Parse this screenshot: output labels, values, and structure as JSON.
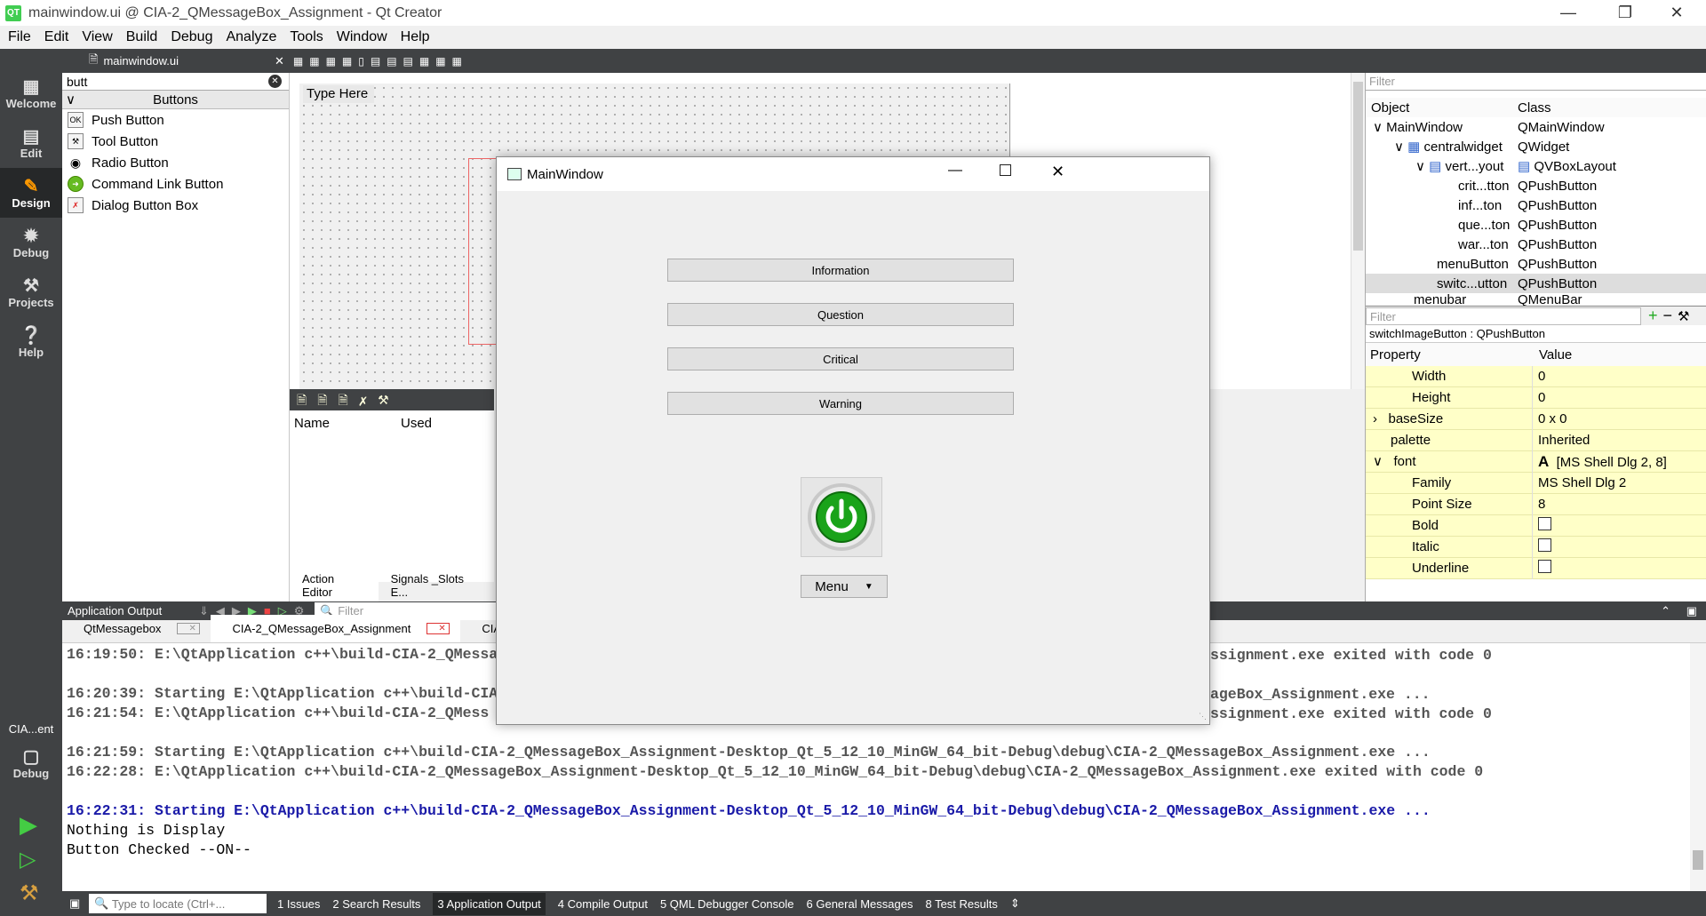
{
  "window": {
    "title": "mainwindow.ui @ CIA-2_QMessageBox_Assignment - Qt Creator",
    "logo": "QT"
  },
  "menubar": [
    "File",
    "Edit",
    "View",
    "Build",
    "Debug",
    "Analyze",
    "Tools",
    "Window",
    "Help"
  ],
  "modes": [
    {
      "label": "Welcome",
      "icon": "grid-icon"
    },
    {
      "label": "Edit",
      "icon": "edit-icon"
    },
    {
      "label": "Design",
      "icon": "design-icon"
    },
    {
      "label": "Debug",
      "icon": "debug-icon"
    },
    {
      "label": "Projects",
      "icon": "wrench-icon"
    },
    {
      "label": "Help",
      "icon": "help-icon"
    }
  ],
  "kit": {
    "name": "CIA...ent",
    "mode": "Debug"
  },
  "toolbar": {
    "file": "mainwindow.ui"
  },
  "widgetbox": {
    "search": "butt",
    "category": "Buttons",
    "items": [
      "Push Button",
      "Tool Button",
      "Radio Button",
      "Command Link Button",
      "Dialog Button Box"
    ]
  },
  "form": {
    "typehere": "Type Here"
  },
  "action_editor": {
    "col_name": "Name",
    "col_used": "Used",
    "tab1": "Action Editor",
    "tab2": "Signals _Slots E..."
  },
  "object_inspector": {
    "filter": "Filter",
    "col_object": "Object",
    "col_class": "Class",
    "rows": [
      {
        "obj": "MainWindow",
        "cls": "QMainWindow"
      },
      {
        "obj": "centralwidget",
        "cls": "QWidget"
      },
      {
        "obj": "vert...yout",
        "cls": "QVBoxLayout"
      },
      {
        "obj": "crit...tton",
        "cls": "QPushButton"
      },
      {
        "obj": "inf...ton",
        "cls": "QPushButton"
      },
      {
        "obj": "que...ton",
        "cls": "QPushButton"
      },
      {
        "obj": "war...ton",
        "cls": "QPushButton"
      },
      {
        "obj": "menuButton",
        "cls": "QPushButton"
      },
      {
        "obj": "switc...utton",
        "cls": "QPushButton"
      },
      {
        "obj": "menubar",
        "cls": "QMenuBar"
      }
    ]
  },
  "property_editor": {
    "filter": "Filter",
    "selected": "switchImageButton : QPushButton",
    "col_property": "Property",
    "col_value": "Value",
    "rows": [
      {
        "p": "Width",
        "v": "0"
      },
      {
        "p": "Height",
        "v": "0"
      },
      {
        "p": "baseSize",
        "v": "0 x 0"
      },
      {
        "p": "palette",
        "v": "Inherited"
      },
      {
        "p": "font",
        "v": "[MS Shell Dlg 2, 8]"
      },
      {
        "p": "Family",
        "v": "MS Shell Dlg 2"
      },
      {
        "p": "Point Size",
        "v": "8"
      },
      {
        "p": "Bold",
        "v": ""
      },
      {
        "p": "Italic",
        "v": ""
      },
      {
        "p": "Underline",
        "v": ""
      }
    ]
  },
  "output": {
    "title": "Application Output",
    "filter": "Filter",
    "tabs": [
      "QtMessagebox",
      "CIA-2_QMessageBox_Assignment",
      "CIA-2_QMessag"
    ],
    "log": [
      {
        "t": "16:19:50: E:\\QtApplication c++\\build-CIA-2_QMessa",
        "s": "grey"
      },
      {
        "t": "",
        "s": "grey"
      },
      {
        "t": "16:20:39: Starting E:\\QtApplication c++\\build-CIA",
        "s": "grey"
      },
      {
        "t": "16:21:54: E:\\QtApplication c++\\build-CIA-2_QMess",
        "s": "grey"
      },
      {
        "t": "",
        "s": "grey"
      },
      {
        "t": "16:21:59: Starting E:\\QtApplication c++\\build-CIA-2_QMessageBox_Assignment-Desktop_Qt_5_12_10_MinGW_64_bit-Debug\\debug\\CIA-2_QMessageBox_Assignment.exe ...",
        "s": "grey"
      },
      {
        "t": "16:22:28: E:\\QtApplication c++\\build-CIA-2_QMessageBox_Assignment-Desktop_Qt_5_12_10_MinGW_64_bit-Debug\\debug\\CIA-2_QMessageBox_Assignment.exe exited with code 0",
        "s": "grey"
      },
      {
        "t": "",
        "s": "grey"
      },
      {
        "t": "16:22:31: Starting E:\\QtApplication c++\\build-CIA-2_QMessageBox_Assignment-Desktop_Qt_5_12_10_MinGW_64_bit-Debug\\debug\\CIA-2_QMessageBox_Assignment.exe ...",
        "s": "blue"
      },
      {
        "t": "Nothing is Display",
        "s": "plain"
      },
      {
        "t": "Button Checked --ON--",
        "s": "plain"
      }
    ],
    "right_fragments": [
      "ssignment.exe exited with code 0",
      "ageBox_Assignment.exe ...",
      "ssignment.exe exited with code 0"
    ]
  },
  "statusbar": {
    "locate": "Type to locate (Ctrl+...",
    "panes": [
      "1  Issues",
      "2  Search Results",
      "3  Application Output",
      "4  Compile Output",
      "5  QML Debugger Console",
      "6  General Messages",
      "8  Test Results"
    ]
  },
  "preview": {
    "title": "MainWindow",
    "buttons": [
      "Information",
      "Question",
      "Critical",
      "Warning"
    ],
    "menu": "Menu",
    "power_color": "#1aa31a"
  }
}
